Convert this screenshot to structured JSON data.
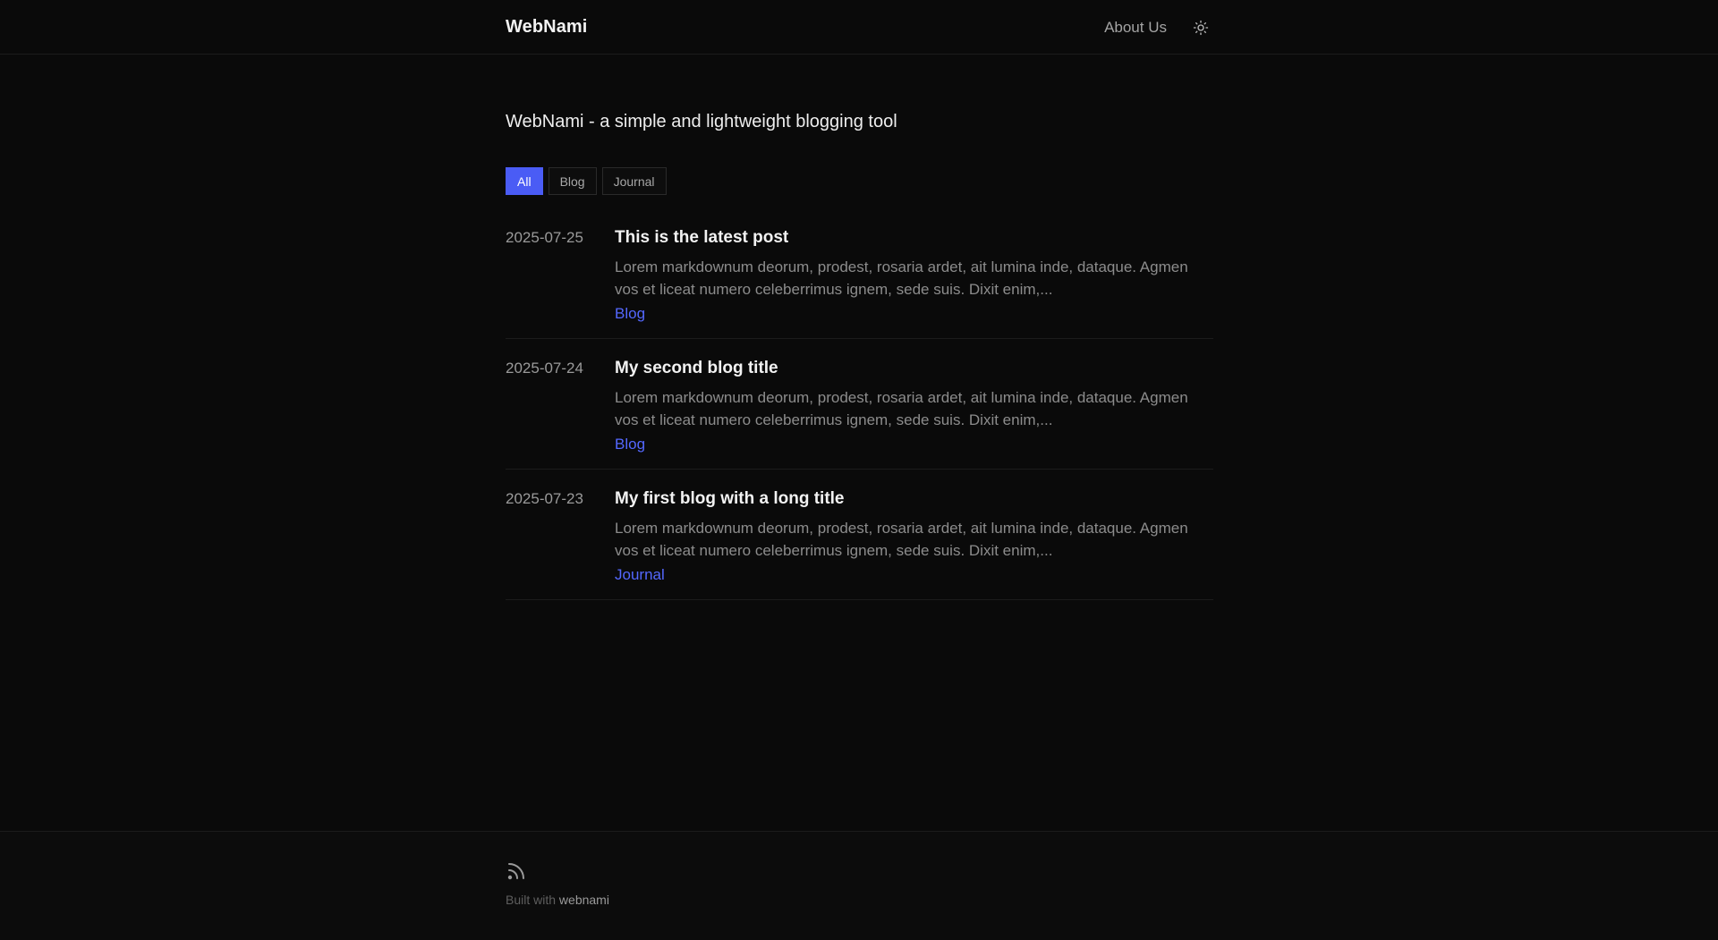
{
  "header": {
    "brand": "WebNami",
    "nav": {
      "about_label": "About Us"
    },
    "theme_toggle_icon": "sun-icon"
  },
  "main": {
    "tagline": "WebNami - a simple and lightweight blogging tool",
    "filters": [
      {
        "label": "All",
        "active": true
      },
      {
        "label": "Blog",
        "active": false
      },
      {
        "label": "Journal",
        "active": false
      }
    ],
    "posts": [
      {
        "date": "2025-07-25",
        "title": "This is the latest post",
        "excerpt": "Lorem markdownum deorum, prodest, rosaria ardet, ait lumina inde, dataque. Agmen vos et liceat numero celeberrimus ignem, sede suis. Dixit enim,...",
        "tag": "Blog"
      },
      {
        "date": "2025-07-24",
        "title": "My second blog title",
        "excerpt": "Lorem markdownum deorum, prodest, rosaria ardet, ait lumina inde, dataque. Agmen vos et liceat numero celeberrimus ignem, sede suis. Dixit enim,...",
        "tag": "Blog"
      },
      {
        "date": "2025-07-23",
        "title": "My first blog with a long title",
        "excerpt": "Lorem markdownum deorum, prodest, rosaria ardet, ait lumina inde, dataque. Agmen vos et liceat numero celeberrimus ignem, sede suis. Dixit enim,...",
        "tag": "Journal"
      }
    ]
  },
  "footer": {
    "rss_icon": "rss-icon",
    "built_prefix": "Built with ",
    "built_link": "webnami"
  },
  "colors": {
    "background": "#0a0a0a",
    "accent": "#4a5cf5",
    "tag": "#5468ff"
  }
}
